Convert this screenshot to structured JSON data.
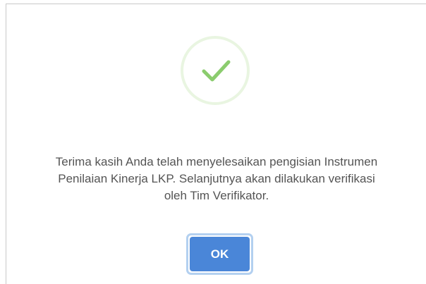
{
  "dialog": {
    "icon": "success-checkmark-icon",
    "icon_color": "#8bcc6e",
    "icon_ring_color": "#e9f5e1",
    "message_lines": [
      "Terima kasih Anda telah menyelesaikan pengisian Instrumen",
      "Penilaian Kinerja LKP. Selanjutnya akan dilakukan verifikasi",
      "oleh Tim Verifikator."
    ],
    "ok_label": "OK",
    "button_color": "#4a86d8",
    "button_focus_ring_color": "#b3d0f0"
  }
}
